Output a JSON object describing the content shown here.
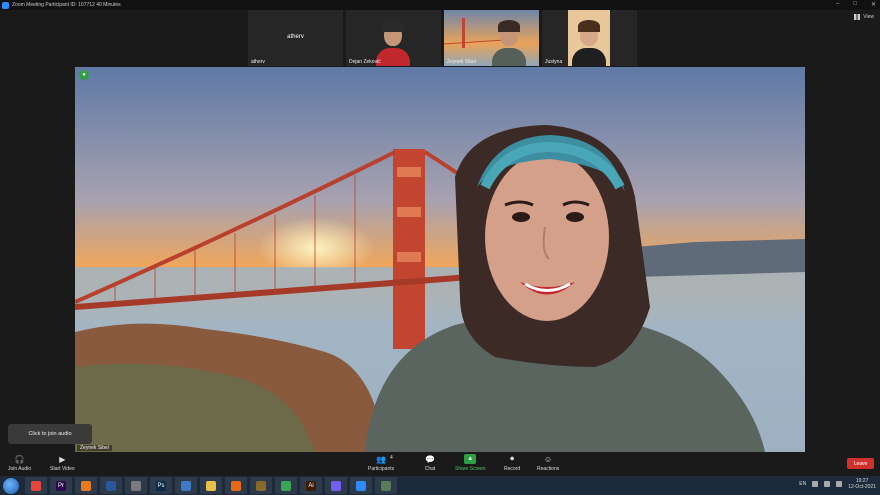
{
  "window": {
    "title": "Zoom Meeting  Participant ID: 107712   40 Minutes",
    "controls": [
      "–",
      "□",
      "✕"
    ]
  },
  "view_button": {
    "label": "View"
  },
  "thumbnails": [
    {
      "name": "atherv",
      "center_label": "atherv",
      "type": "name-only"
    },
    {
      "name": "Dejan Zeković",
      "type": "video"
    },
    {
      "name": "Zeynek Sibel",
      "type": "video",
      "active": true
    },
    {
      "name": "Justyna",
      "type": "video"
    }
  ],
  "main_video": {
    "speaker_name": "Zeynek Sibel",
    "unmuted_icon": "mic-on-icon"
  },
  "tooltip": {
    "text": "Click to join audio"
  },
  "controls": {
    "join_audio": "Join Audio",
    "start_video": "Start Video",
    "participants": "Participants",
    "participants_count": "4",
    "chat": "Chat",
    "share_screen": "Share Screen",
    "record": "Record",
    "reactions": "Reactions",
    "leave": "Leave"
  },
  "taskbar": {
    "apps": [
      {
        "name": "chrome-app",
        "color": "#e8453c"
      },
      {
        "name": "premiere-app",
        "color": "#2a0a4a",
        "glyph": "Pr"
      },
      {
        "name": "ms-app",
        "color": "#e97a1f"
      },
      {
        "name": "word-app",
        "color": "#2b579a"
      },
      {
        "name": "save-app",
        "color": "#7a7a7a"
      },
      {
        "name": "photoshop-app",
        "color": "#0a2a4a",
        "glyph": "Ps"
      },
      {
        "name": "network-app",
        "color": "#3d7bc4"
      },
      {
        "name": "folder-app",
        "color": "#e7c04a"
      },
      {
        "name": "firefox-app",
        "color": "#e66a1a"
      },
      {
        "name": "magic-app",
        "color": "#8a6a2a"
      },
      {
        "name": "chrome2-app",
        "color": "#3aa655"
      },
      {
        "name": "illustrator-app",
        "color": "#3a1a00",
        "glyph": "Ai"
      },
      {
        "name": "viber-app",
        "color": "#7360f2"
      },
      {
        "name": "zoom-app",
        "color": "#2d8cff"
      },
      {
        "name": "photo-app",
        "color": "#5a7a5a"
      }
    ],
    "language": "EN",
    "time": "19:27",
    "date": "12-Oct-2021"
  }
}
